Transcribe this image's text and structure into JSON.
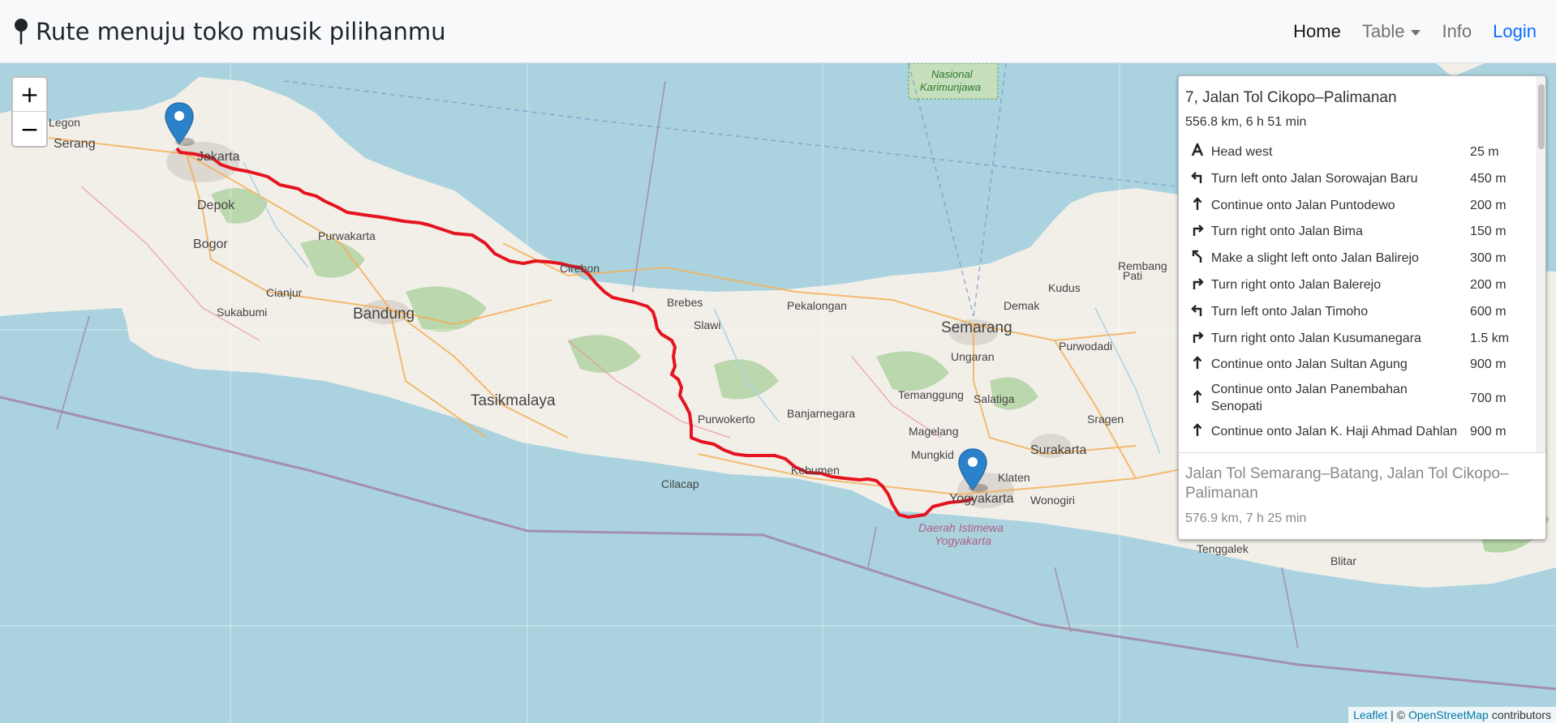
{
  "navbar": {
    "brand": "Rute menuju toko musik pilihanmu",
    "brand_icon": "map-pin-icon",
    "items": [
      {
        "label": "Home",
        "active": true
      },
      {
        "label": "Table",
        "dropdown": true
      },
      {
        "label": "Info"
      },
      {
        "label": "Login"
      }
    ]
  },
  "zoom": {
    "in": "+",
    "out": "−"
  },
  "map": {
    "places": [
      "Serang",
      "Jakarta",
      "Depok",
      "Bogor",
      "Purwakarta",
      "Cianjur",
      "Sukabumi",
      "Bandung",
      "Tasikmalaya",
      "Cirebon",
      "Brebes",
      "Slawi",
      "Pekalongan",
      "Semarang",
      "Demak",
      "Kudus",
      "Pati",
      "Rembang",
      "Ungaran",
      "Purwodadi",
      "Salatiga",
      "Temanggung",
      "Magelang",
      "Mungkid",
      "Sragen",
      "Surakarta",
      "Klaten",
      "Yogyakarta",
      "Wonogiri",
      "Purwokerto",
      "Banjarnegara",
      "Kebumen",
      "Cilacap",
      "Tenggalek",
      "Blitar",
      "Legon"
    ],
    "park_label": "Nasional Karimunjawa",
    "region_label": "Daerah Istimewa Yogyakarta"
  },
  "routing": {
    "primary": {
      "title": "7, Jalan Tol Cikopo–Palimanan",
      "summary": "556.8 km, 6 h 51 min",
      "steps": [
        {
          "icon": "depart-icon",
          "text": "Head west",
          "dist": "25 m"
        },
        {
          "icon": "turn-left-icon",
          "text": "Turn left onto Jalan Sorowajan Baru",
          "dist": "450 m"
        },
        {
          "icon": "straight-icon",
          "text": "Continue onto Jalan Puntodewo",
          "dist": "200 m"
        },
        {
          "icon": "turn-right-icon",
          "text": "Turn right onto Jalan Bima",
          "dist": "150 m"
        },
        {
          "icon": "slight-left-icon",
          "text": "Make a slight left onto Jalan Balirejo",
          "dist": "300 m"
        },
        {
          "icon": "turn-right-icon",
          "text": "Turn right onto Jalan Balerejo",
          "dist": "200 m"
        },
        {
          "icon": "turn-left-icon",
          "text": "Turn left onto Jalan Timoho",
          "dist": "600 m"
        },
        {
          "icon": "turn-right-icon",
          "text": "Turn right onto Jalan Kusumanegara",
          "dist": "1.5 km"
        },
        {
          "icon": "straight-icon",
          "text": "Continue onto Jalan Sultan Agung",
          "dist": "900 m"
        },
        {
          "icon": "straight-icon",
          "text": "Continue onto Jalan Panembahan Senopati",
          "dist": "700 m"
        },
        {
          "icon": "straight-icon",
          "text": "Continue onto Jalan K. Haji Ahmad Dahlan",
          "dist": "900 m"
        }
      ]
    },
    "alternative": {
      "title": "Jalan Tol Semarang–Batang, Jalan Tol Cikopo–Palimanan",
      "summary": "576.9 km, 7 h 25 min"
    }
  },
  "attribution": {
    "leaflet": "Leaflet",
    "sep": "| ©",
    "osm": "OpenStreetMap",
    "suffix": "contributors"
  },
  "colors": {
    "route": "#e5141e",
    "marker": "#2b82cb",
    "link": "#0d6efd",
    "land": "#f2efe9",
    "sea": "#aad3df"
  }
}
